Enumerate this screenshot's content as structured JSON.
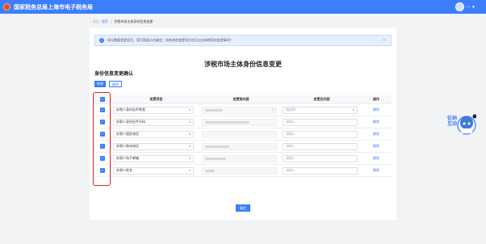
{
  "header": {
    "title": "国家税务总局上海市电子税务局",
    "user_name": "---"
  },
  "breadcrumb": {
    "back": "返回",
    "home": "首页",
    "current": "涉税市场主体身份信息变更"
  },
  "notice": {
    "text": "如无需要变更项目，您可直接点击确定；如有其他变更项目也可点击新增添加变更事项！",
    "close": "×"
  },
  "page": {
    "title": "涉税市场主体身份信息变更",
    "section_title": "身份信息变更确认"
  },
  "actions": {
    "add": "新增",
    "delete": "删除",
    "confirm": "确定"
  },
  "table": {
    "headers": [
      "变更项目",
      "变更前内容",
      "变更后内容",
      "操作"
    ],
    "rows": [
      {
        "item": "办税人身份证件种类",
        "after": "请选择",
        "op": "删除"
      },
      {
        "item": "办税人身份证件号码",
        "after": "请输入",
        "op": "删除"
      },
      {
        "item": "办税人固定电话",
        "after": "请输入",
        "op": "删除"
      },
      {
        "item": "办税人移动电话",
        "after": "请输入",
        "op": "删除"
      },
      {
        "item": "办税人电子邮箱",
        "after": "请输入",
        "op": "删除"
      },
      {
        "item": "办税人姓名",
        "after": "请输入",
        "op": "删除"
      }
    ]
  },
  "mascot": {
    "text": "征纳互动"
  },
  "colors": {
    "primary": "#3d7dff",
    "highlight": "#e02020"
  }
}
